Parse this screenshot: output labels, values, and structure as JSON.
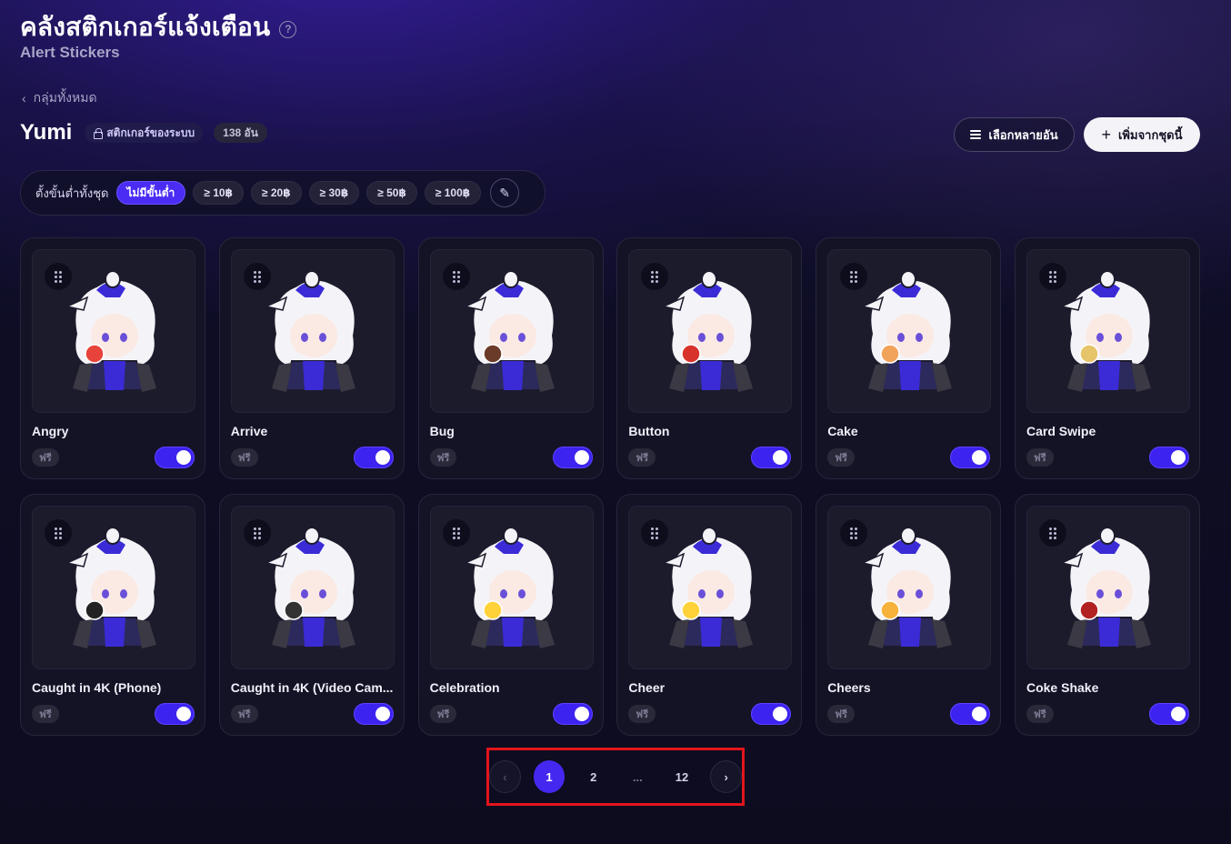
{
  "header": {
    "title": "คลังสติกเกอร์แจ้งเตือน",
    "subtitle": "Alert Stickers",
    "back_label": "กลุ่มทั้งหมด"
  },
  "pack": {
    "name": "Yumi",
    "system_tag": "สติกเกอร์ของระบบ",
    "count": "138 อัน"
  },
  "actions": {
    "multi_select_label": "เลือกหลายอัน",
    "add_label": "เพิ่มจากชุดนี้"
  },
  "filter": {
    "label": "ตั้งขั้นต่ำทั้งชุด",
    "chips": [
      "ไม่มีขั้นต่ำ",
      "≥ 10฿",
      "≥ 20฿",
      "≥ 30฿",
      "≥ 50฿",
      "≥ 100฿"
    ],
    "active_index": 0
  },
  "stickers": [
    {
      "name": "Angry",
      "price": "ฟรี",
      "enabled": true,
      "prop": "#e8433a"
    },
    {
      "name": "Arrive",
      "price": "ฟรี",
      "enabled": true,
      "prop": ""
    },
    {
      "name": "Bug",
      "price": "ฟรี",
      "enabled": true,
      "prop": "#6b3b2a"
    },
    {
      "name": "Button",
      "price": "ฟรี",
      "enabled": true,
      "prop": "#d8322c"
    },
    {
      "name": "Cake",
      "price": "ฟรี",
      "enabled": true,
      "prop": "#f2a35a"
    },
    {
      "name": "Card Swipe",
      "price": "ฟรี",
      "enabled": true,
      "prop": "#e6c46a"
    },
    {
      "name": "Caught in 4K (Phone)",
      "price": "ฟรี",
      "enabled": true,
      "prop": "#222"
    },
    {
      "name": "Caught in 4K (Video Cam...",
      "price": "ฟรี",
      "enabled": true,
      "prop": "#333"
    },
    {
      "name": "Celebration",
      "price": "ฟรี",
      "enabled": true,
      "prop": "#ffd23a"
    },
    {
      "name": "Cheer",
      "price": "ฟรี",
      "enabled": true,
      "prop": "#ffd23a"
    },
    {
      "name": "Cheers",
      "price": "ฟรี",
      "enabled": true,
      "prop": "#f6b23a"
    },
    {
      "name": "Coke Shake",
      "price": "ฟรี",
      "enabled": true,
      "prop": "#b22222"
    }
  ],
  "pagination": {
    "prev": "‹",
    "pages": [
      "1",
      "2",
      "...",
      "12"
    ],
    "current": "1",
    "next": "›"
  },
  "colors": {
    "accent": "#4428f0",
    "highlight_border": "#e3141c"
  }
}
